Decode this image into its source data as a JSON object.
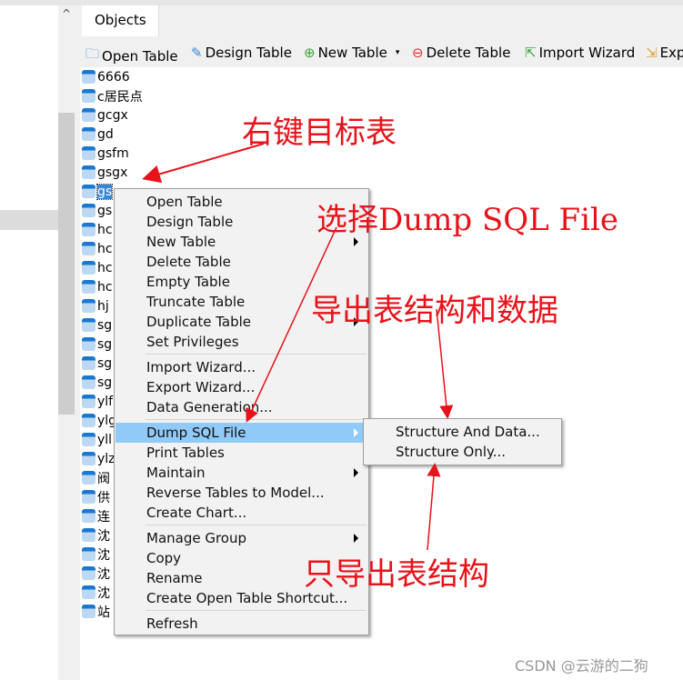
{
  "tab": {
    "label": "Objects"
  },
  "toolbar": {
    "open": "Open Table",
    "design": "Design Table",
    "new": "New Table",
    "delete": "Delete Table",
    "import": "Import Wizard",
    "export": "Exp"
  },
  "tables": [
    "6666",
    "c居民点",
    "gcgx",
    "gd",
    "gsfm",
    "gsgx",
    "gs",
    "gs",
    "hc",
    "hc",
    "hc",
    "hc",
    "hj",
    "sg",
    "sg",
    "sg",
    "sg",
    "ylf",
    "ylg",
    "yll",
    "ylz",
    "阀",
    "供",
    "连",
    "沈",
    "沈",
    "沈",
    "沈",
    "站"
  ],
  "selected_index": 6,
  "menu": {
    "items": [
      "Open Table",
      "Design Table",
      "New Table",
      "Delete Table",
      "Empty Table",
      "Truncate Table",
      "Duplicate Table",
      "Set Privileges",
      "Import Wizard...",
      "Export Wizard...",
      "Data Generation...",
      "Dump SQL File",
      "Print Tables",
      "Maintain",
      "Reverse Tables to Model...",
      "Create Chart...",
      "Manage Group",
      "Copy",
      "Rename",
      "Create Open Table Shortcut...",
      "Refresh"
    ]
  },
  "submenu": {
    "items": [
      "Structure And Data...",
      "Structure Only..."
    ]
  },
  "annotations": {
    "a1": "右键目标表",
    "a2": "选择Dump SQL File",
    "a3": "导出表结构和数据",
    "a4": "只导出表结构"
  },
  "watermark": "CSDN @云游的二狗",
  "colors": {
    "annotation": "#e8121a",
    "highlight": "#91c9f7",
    "selection": "#3a87d6"
  }
}
